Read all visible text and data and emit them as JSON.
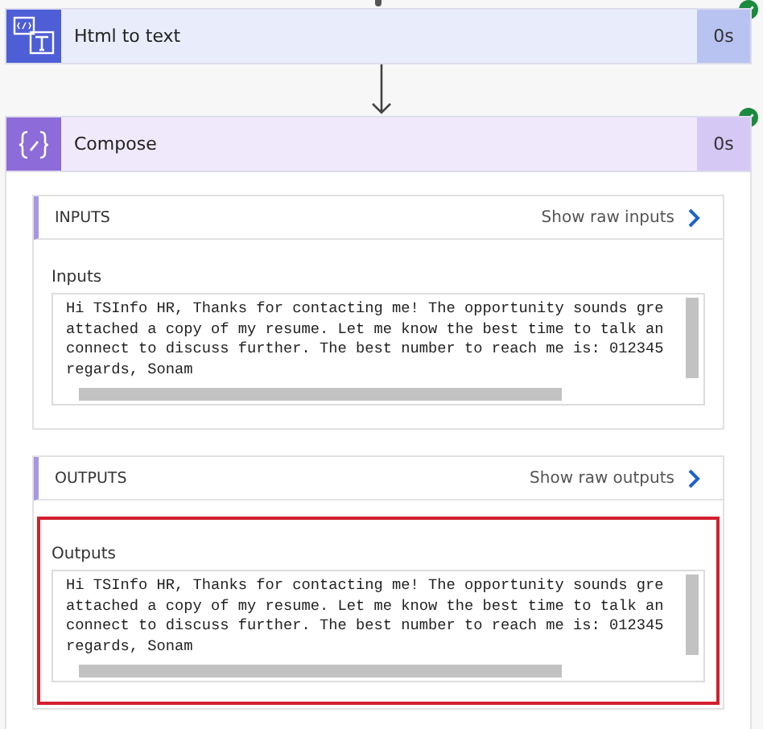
{
  "steps": [
    {
      "kind": "html-to-text",
      "title": "Html to text",
      "duration": "0s",
      "succeeded": true
    },
    {
      "kind": "compose",
      "title": "Compose",
      "duration": "0s",
      "succeeded": true
    }
  ],
  "sections": [
    {
      "heading": "INPUTS",
      "raw_link": "Show raw inputs",
      "label": "Inputs",
      "highlighted": false,
      "lines": [
        "Hi TSInfo HR, Thanks for contacting me! The opportunity sounds gre",
        "attached a copy of my resume. Let me know the best time to talk an",
        "connect to discuss further. The best number to reach me is: 012345",
        "regards, Sonam"
      ]
    },
    {
      "heading": "OUTPUTS",
      "raw_link": "Show raw outputs",
      "label": "Outputs",
      "highlighted": true,
      "lines": [
        "Hi TSInfo HR, Thanks for contacting me! The opportunity sounds gre",
        "attached a copy of my resume. Let me know the best time to talk an",
        "connect to discuss further. The best number to reach me is: 012345",
        "regards, Sonam"
      ]
    }
  ]
}
